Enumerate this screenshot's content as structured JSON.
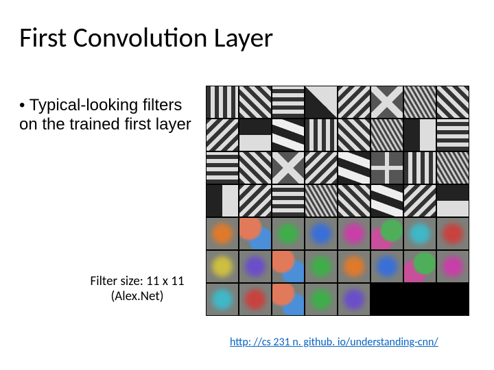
{
  "title": "First Convolution Layer",
  "bullet": {
    "dot": "•",
    "text": "Typical-looking filters on the trained first layer"
  },
  "caption": {
    "line1": "Filter size: 11 x 11",
    "line2": "(Alex.Net)"
  },
  "link_text": "http: //cs 231 n. github. io/understanding-cnn/",
  "link_href": "http://cs231n.github.io/understanding-cnn/",
  "filters": {
    "rows": 7,
    "cols": 8,
    "black_tiles": 3,
    "types": [
      "gabor",
      "edge",
      "color-blob"
    ]
  }
}
